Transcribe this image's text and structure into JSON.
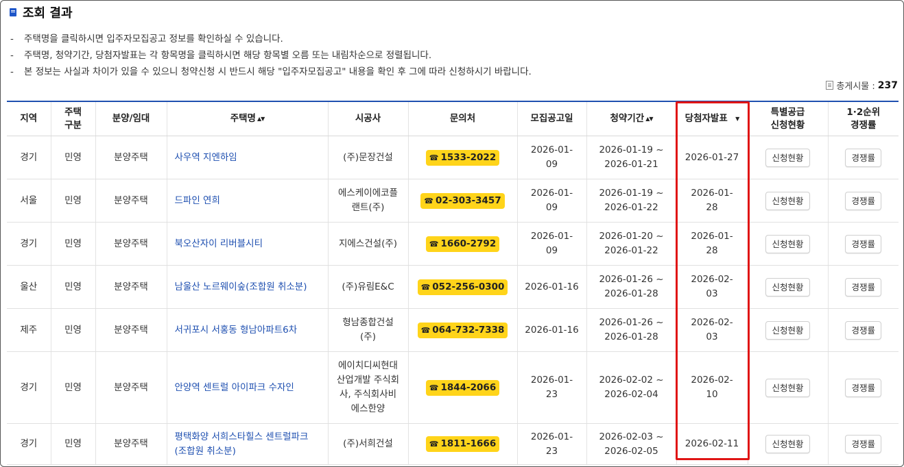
{
  "header": {
    "title": "조회 결과"
  },
  "notes": [
    "주택명을 클릭하시면 입주자모집공고 정보를 확인하실 수 있습니다.",
    "주택명, 청약기간, 당첨자발표는 각 항목명을 클릭하시면 해당 항목별 오름 또는 내림차순으로 정렬됩니다.",
    "본 정보는 사실과 차이가 있을 수 있으니 청약신청 시 반드시 해당 \"입주자모집공고\" 내용을 확인 후 그에 따라 신청하시기 바랍니다."
  ],
  "note_dash": "-",
  "total": {
    "label": "총게시물 :",
    "count": "237"
  },
  "columns": {
    "region": "지역",
    "type_line1": "주택",
    "type_line2": "구분",
    "supply": "분양/임대",
    "name": "주택명",
    "builder": "시공사",
    "contact": "문의처",
    "notice_date": "모집공고일",
    "period": "청약기간",
    "winner": "당첨자발표",
    "special_line1": "특별공급",
    "special_line2": "신청현황",
    "rate_line1": "1·2순위",
    "rate_line2": "경쟁률"
  },
  "sort_icons": {
    "both": "▲▼",
    "desc": "▼"
  },
  "phone_icon": "☎",
  "buttons": {
    "status": "신청현황",
    "rate": "경쟁률"
  },
  "rows": [
    {
      "region": "경기",
      "type": "민영",
      "supply": "분양주택",
      "name": "사우역 지엔하임",
      "builder": "(주)문장건설",
      "phone": "1533-2022",
      "notice": "2026-01-\n09",
      "period": "2026-01-19 ~\n2026-01-21",
      "winner": "2026-01-27"
    },
    {
      "region": "서울",
      "type": "민영",
      "supply": "분양주택",
      "name": "드파인 연희",
      "builder": "에스케이에코플\n랜트(주)",
      "phone": "02-303-3457",
      "notice": "2026-01-\n09",
      "period": "2026-01-19 ~\n2026-01-22",
      "winner": "2026-01-\n28"
    },
    {
      "region": "경기",
      "type": "민영",
      "supply": "분양주택",
      "name": "북오산자이 리버블시티",
      "builder": "지에스건설(주)",
      "phone": "1660-2792",
      "notice": "2026-01-\n09",
      "period": "2026-01-20 ~\n2026-01-22",
      "winner": "2026-01-\n28"
    },
    {
      "region": "울산",
      "type": "민영",
      "supply": "분양주택",
      "name": "남울산 노르웨이숲(조합원 취소분)",
      "builder": "(주)유림E&C",
      "phone": "052-256-0300",
      "notice": "2026-01-16",
      "period": "2026-01-26 ~\n2026-01-28",
      "winner": "2026-02-\n03"
    },
    {
      "region": "제주",
      "type": "민영",
      "supply": "분양주택",
      "name": "서귀포시 서홍동 형남아파트6차",
      "builder": "형남종합건설\n(주)",
      "phone": "064-732-7338",
      "notice": "2026-01-16",
      "period": "2026-01-26 ~\n2026-01-28",
      "winner": "2026-02-\n03"
    },
    {
      "region": "경기",
      "type": "민영",
      "supply": "분양주택",
      "name": "안양역 센트럴 아이파크 수자인",
      "builder": "에이치디씨현대\n산업개발 주식회\n사, 주식회사비\n에스한양",
      "phone": "1844-2066",
      "notice": "2026-01-\n23",
      "period": "2026-02-02 ~\n2026-02-04",
      "winner": "2026-02-\n10"
    },
    {
      "region": "경기",
      "type": "민영",
      "supply": "분양주택",
      "name": "평택화양 서희스타힐스 센트럴파크\n(조합원 취소분)",
      "builder": "(주)서희건설",
      "phone": "1811-1666",
      "notice": "2026-01-\n23",
      "period": "2026-02-03 ~\n2026-02-05",
      "winner": "2026-02-11"
    }
  ],
  "colors": {
    "accent": "#1e4fb0",
    "phone_bg": "#ffd41a",
    "highlight": "#e01414"
  }
}
